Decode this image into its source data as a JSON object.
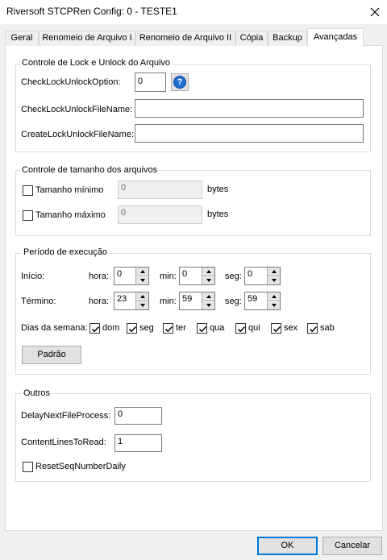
{
  "window": {
    "title": "Riversoft STCPRen Config: 0 - TESTE1",
    "close_icon": "close-icon"
  },
  "tabs": [
    {
      "label": "Geral"
    },
    {
      "label": "Renomeio de Arquivo I"
    },
    {
      "label": "Renomeio de Arquivo II"
    },
    {
      "label": "Cópia"
    },
    {
      "label": "Backup"
    },
    {
      "label": "Avançadas",
      "active": true
    }
  ],
  "lock_group": {
    "title": "Controle de Lock e Unlock do Arquivo",
    "option_label": "CheckLockUnlockOption:",
    "option_value": "0",
    "help_icon": "help-icon",
    "file_name_label": "CheckLockUnlockFileName:",
    "file_name_value": "",
    "create_label": "CreateLockUnlockFileName:",
    "create_value": ""
  },
  "size_group": {
    "title": "Controle de tamanho dos arquivos",
    "min_label": "Tamanho mínimo",
    "min_checked": false,
    "min_value": "0",
    "min_unit": "bytes",
    "max_label": "Tamanho máximo",
    "max_checked": false,
    "max_value": "0",
    "max_unit": "bytes"
  },
  "period_group": {
    "title": "Período de execução",
    "start_label": "Início:",
    "end_label": "Término:",
    "hour_label": "hora:",
    "min_label": "min:",
    "sec_label": "seg:",
    "start": {
      "hour": "0",
      "min": "0",
      "sec": "0"
    },
    "end": {
      "hour": "23",
      "min": "59",
      "sec": "59"
    },
    "days_label": "Dias da semana:",
    "days": [
      {
        "label": "dom",
        "checked": true
      },
      {
        "label": "seg",
        "checked": true
      },
      {
        "label": "ter",
        "checked": true
      },
      {
        "label": "qua",
        "checked": true
      },
      {
        "label": "qui",
        "checked": true
      },
      {
        "label": "sex",
        "checked": true
      },
      {
        "label": "sab",
        "checked": true
      }
    ],
    "default_button": "Padrão"
  },
  "others_group": {
    "title": "Outros",
    "delay_label": "DelayNextFileProcess:",
    "delay_value": "0",
    "lines_label": "ContentLinesToRead:",
    "lines_value": "1",
    "reset_label": "ResetSeqNumberDaily",
    "reset_checked": false
  },
  "footer": {
    "ok": "OK",
    "cancel": "Cancelar"
  }
}
